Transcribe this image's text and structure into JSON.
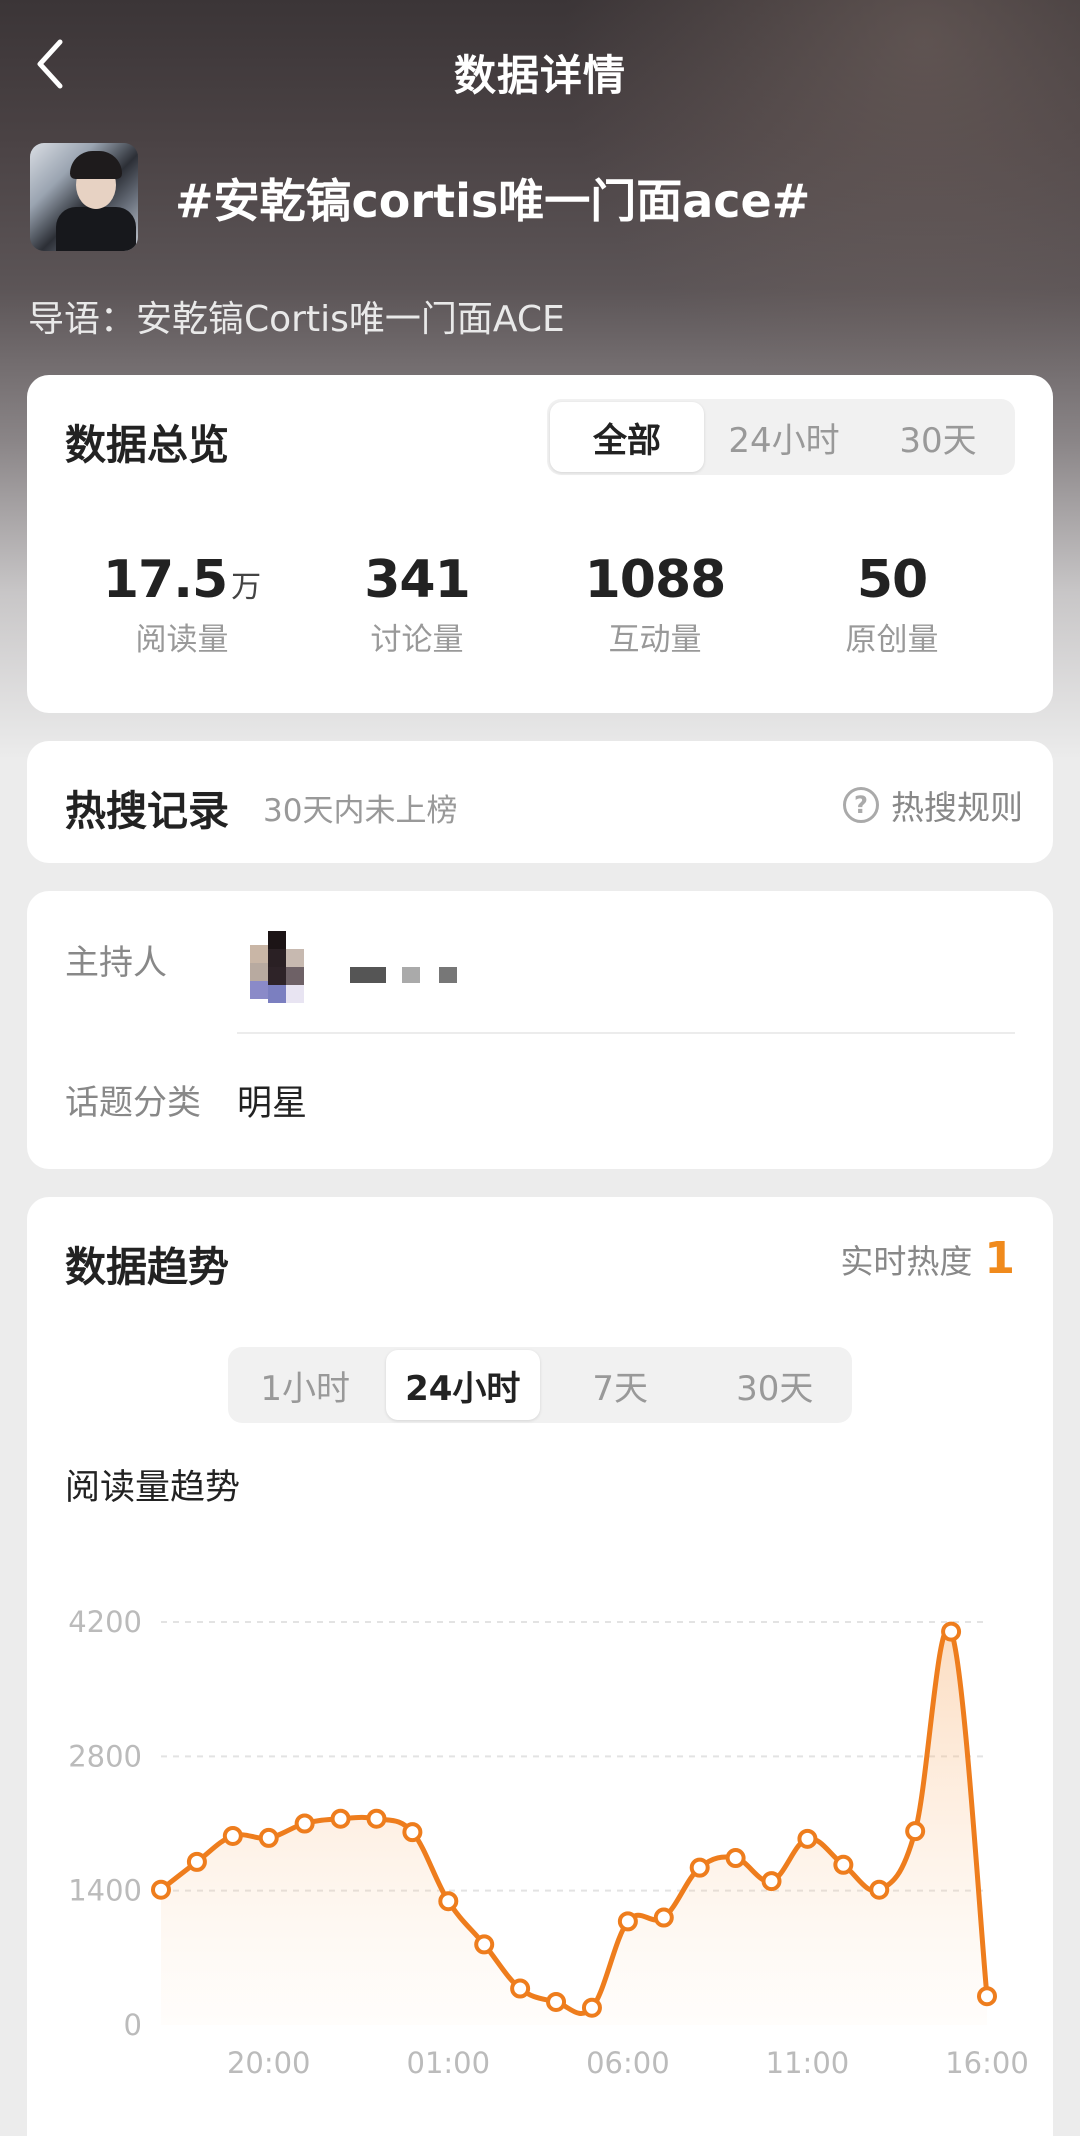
{
  "header": {
    "title": "数据详情"
  },
  "topic": {
    "title": "#安乾镐cortis唯一门面ace#",
    "lead": "导语：安乾镐Cortis唯一门面ACE"
  },
  "overview": {
    "title": "数据总览",
    "tabs": [
      "全部",
      "24小时",
      "30天"
    ],
    "active_tab": "全部",
    "stats": [
      {
        "value": "17.5",
        "unit": "万",
        "label": "阅读量"
      },
      {
        "value": "341",
        "unit": "",
        "label": "讨论量"
      },
      {
        "value": "1088",
        "unit": "",
        "label": "互动量"
      },
      {
        "value": "50",
        "unit": "",
        "label": "原创量"
      }
    ]
  },
  "hot_search": {
    "title": "热搜记录",
    "subtitle": "30天内未上榜",
    "rule_label": "热搜规则"
  },
  "info": {
    "host_label": "主持人",
    "category_label": "话题分类",
    "category_value": "明星"
  },
  "trend": {
    "title": "数据趋势",
    "heat_label": "实时热度",
    "heat_value": "1",
    "tabs": [
      "1小时",
      "24小时",
      "7天",
      "30天"
    ],
    "active_tab": "24小时",
    "chart_label": "阅读量趋势"
  },
  "colors": {
    "accent": "#f08a1c",
    "line": "#ee7d1d"
  },
  "chart_data": {
    "type": "area",
    "title": "阅读量趋势",
    "xlabel": "",
    "ylabel": "",
    "x_tick_labels": [
      "20:00",
      "01:00",
      "06:00",
      "11:00",
      "16:00"
    ],
    "x_tick_index": [
      3,
      8,
      13,
      18,
      23
    ],
    "y_ticks": [
      0,
      1400,
      2800,
      4200
    ],
    "ylim": [
      0,
      4200
    ],
    "grid": true,
    "series": [
      {
        "values": [
          1410,
          1700,
          1970,
          1950,
          2100,
          2150,
          2150,
          2010,
          1290,
          840,
          380,
          240,
          180,
          1080,
          1120,
          1640,
          1740,
          1500,
          1940,
          1670,
          1410,
          2020,
          4100,
          300
        ]
      }
    ]
  }
}
